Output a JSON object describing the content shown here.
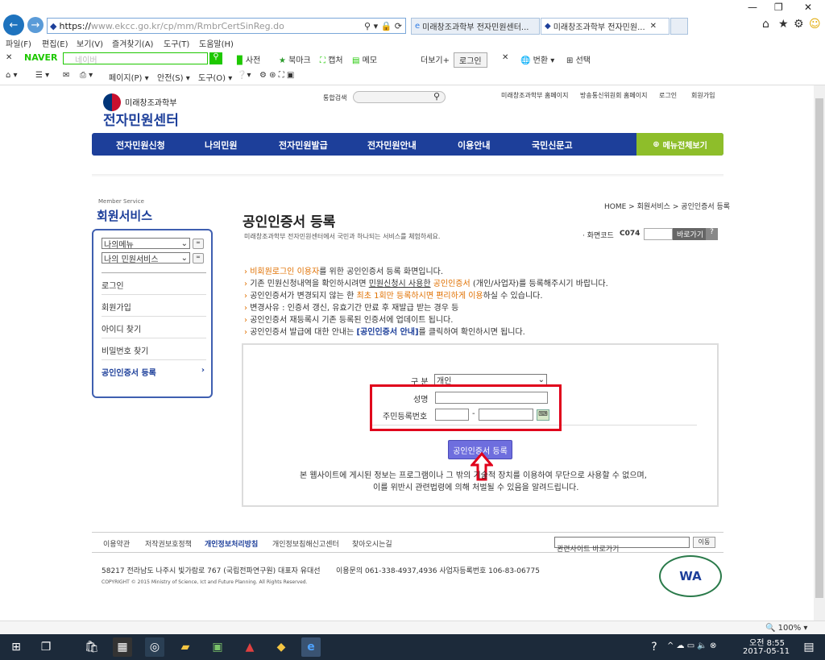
{
  "browser": {
    "url": "https://www.ekcc.go.kr/cp/mm/RmbrCertSinReg.do",
    "url_prefix": "https://",
    "url_host": "www.ekcc.go.kr",
    "url_path": "/cp/mm/RmbrCertSinReg.do",
    "tabs": [
      {
        "label": "미래창조과학부 전자민원센터..."
      },
      {
        "label": "미래창조과학부 전자민원..."
      }
    ],
    "menu": [
      "파일(F)",
      "편집(E)",
      "보기(V)",
      "즐겨찾기(A)",
      "도구(T)",
      "도움말(H)"
    ],
    "naver": {
      "brand": "NAVER",
      "search_placeholder": "네이버",
      "items": [
        "사전",
        "북마크",
        "캡처",
        "메모"
      ],
      "more": "더보기+",
      "login": "로그인",
      "translate": "번환",
      "select": "선택"
    },
    "cmd": {
      "page": "페이지(P)",
      "safety": "안전(S)",
      "tools": "도구(O)"
    },
    "zoom": "100%"
  },
  "site": {
    "ministry": "미래창조과학부",
    "title": "전자민원센터",
    "search_label": "통합검색",
    "top_links": [
      "미래창조과학부 홈페이지",
      "방송통신위원회 홈페이지",
      "로그인",
      "회원가입"
    ],
    "gnb": [
      "전자민원신청",
      "나의민원",
      "전자민원발급",
      "전자민원안내",
      "이용안내",
      "국민신문고"
    ],
    "all_menu": "메뉴전체보기"
  },
  "lnb": {
    "caption": "Member Service",
    "title": "회원서비스",
    "select1": "나의메뉴",
    "select2": "나의 민원서비스",
    "items": [
      "로그인",
      "회원가입",
      "아이디 찾기",
      "비밀번호 찾기",
      "공인인증서 등록"
    ]
  },
  "main": {
    "breadcrumb": "HOME > 회원서비스 > 공인인증서 등록",
    "title": "공인인증서 등록",
    "subtitle": "미래창조과학부 전자민원센터에서 국민과 하나되는 서비스를 체험하세요.",
    "screen_code_label": "· 화면코드",
    "screen_code": "C074",
    "go_button": "바로가기",
    "help_button": "?",
    "notices": {
      "n1a": "비회원로그인 이용자",
      "n1b": "를 위한 공인인증서 등록 화면입니다.",
      "n2a": "기존 민원신청내역을 확인하시려면 ",
      "n2b": "민원신청시 사용한",
      "n2c": " 공인인증서",
      "n2d": " (개인/사업자)를 등록해주시기 바랍니다.",
      "n3a": "공인인증서가 변경되지 않는 한 ",
      "n3b": "최초 1회만 등록하시면 편리하게 이용",
      "n3c": "하실 수 있습니다.",
      "n4": "변경사유 : 인증서 갱신, 유효기간 만료 후 재발급 받는 경우 등",
      "n5": "공인인증서 재등록시 기존 등록된 인증서에 업데이트 됩니다.",
      "n6a": "공인인증서 발급에 대한 안내는 ",
      "n6b": "[공인인증서 안내]",
      "n6c": "를 클릭하여 확인하시면 됩니다."
    },
    "form": {
      "type_label": "구 분",
      "type_value": "개인",
      "name_label": "성명",
      "rrn_label": "주민등록번호",
      "rrn_sep": "-",
      "submit": "공인인증서 등록",
      "disclaimer1": "본 웹사이트에 게시된 정보는 프로그램이나 그 밖의 기술적 장치를 이용하여 무단으로 사용할 수 없으며,",
      "disclaimer2": "이를 위반시 관련법령에 의해 처벌될 수 있음을 알려드립니다."
    }
  },
  "footer": {
    "links": [
      "이용약관",
      "저작권보호정책",
      "개인정보처리방침",
      "개인정보침해신고센터",
      "찾아오시는길"
    ],
    "related_select": "관련사이트 바로가기",
    "move": "이동",
    "address": "58217 전라남도 나주시 빛가람로 767 (국립전파연구원) 대표자 유대선",
    "contact": "이용문의 061-338-4937,4936   사업자등록번호 106-83-06775",
    "copyright": "COPYRIGHT © 2015 Ministry of Science, Ict and Future Planning. All Rights Reserved.",
    "badge": "WA"
  },
  "taskbar": {
    "time": "오전 8:55",
    "date": "2017-05-11"
  }
}
